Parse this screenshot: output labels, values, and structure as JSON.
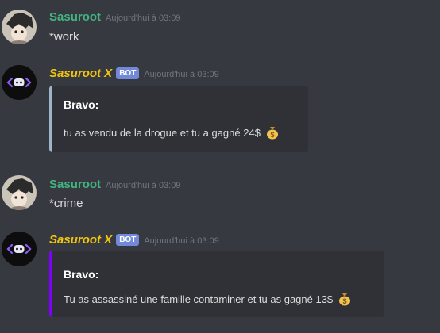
{
  "messages": [
    {
      "author": "Sasuroot",
      "timestamp": "Aujourd'hui à 03:09",
      "content": "*work",
      "avatar": "anime-avatar-icon"
    },
    {
      "author": "Sasuroot X",
      "bot_tag": "BOT",
      "timestamp": "Aujourd'hui à 03:09",
      "avatar": "bot-avatar-icon",
      "embed": {
        "title": "Bravo:",
        "description": "tu as vendu de la drogue et tu a gagné 24$",
        "emoji": "money-bag-icon",
        "border_color": "#9fb4c6"
      }
    },
    {
      "author": "Sasuroot",
      "timestamp": "Aujourd'hui à 03:09",
      "content": "*crime",
      "avatar": "anime-avatar-icon"
    },
    {
      "author": "Sasuroot X",
      "bot_tag": "BOT",
      "timestamp": "Aujourd'hui à 03:09",
      "avatar": "bot-avatar-icon",
      "embed": {
        "title": "Bravo:",
        "description": "Tu as assassiné une famille contaminer et tu as gagné 13$",
        "emoji": "money-bag-icon",
        "border_color": "#7f00ff"
      }
    }
  ],
  "colors": {
    "background": "#36393f",
    "embed_background": "#2f3136",
    "user_name": "#43b581",
    "bot_name": "#f1c40f",
    "bot_tag": "#7289da"
  }
}
